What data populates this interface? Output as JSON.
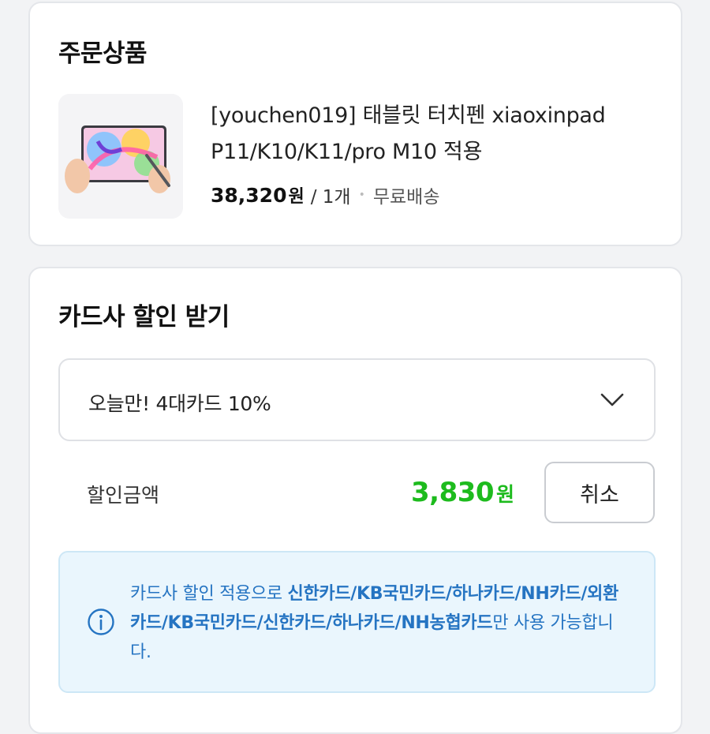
{
  "order_section": {
    "title": "주문상품",
    "product": {
      "name": "[youchen019] 태블릿 터치펜 xiaoxinpad P11/K10/K11/pro M10 적용",
      "price": "38,320",
      "currency": "원",
      "quantity": "/ 1개",
      "separator": "•",
      "shipping": "무료배송"
    }
  },
  "discount_section": {
    "title": "카드사 할인 받기",
    "select": {
      "value": "오늘만! 4대카드 10%",
      "icon": "chevron-down-icon"
    },
    "discount_label": "할인금액",
    "discount_amount": "3,830",
    "discount_currency": "원",
    "cancel_label": "취소",
    "info": {
      "icon": "info-icon",
      "prefix": "카드사 할인 적용으로 ",
      "cards": "신한카드/KB국민카드/하나카드/NH카드/외환카드/KB국민카드/신한카드/하나카드/NH농협카드",
      "suffix": "만 사용 가능합니다."
    }
  },
  "colors": {
    "accent_green": "#1dbb1d",
    "info_blue": "#2574c2",
    "info_bg": "#eaf6fd"
  }
}
